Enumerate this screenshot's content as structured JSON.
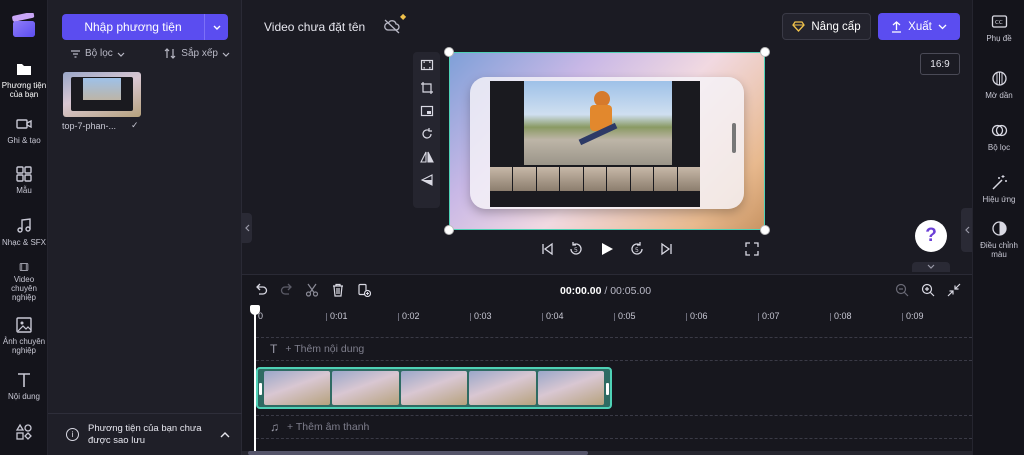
{
  "rail": {
    "items": [
      {
        "label": "Phương tiện của bạn",
        "icon": "folder-icon"
      },
      {
        "label": "Ghi & tạo",
        "icon": "camera-icon"
      },
      {
        "label": "Mẫu",
        "icon": "templates-icon"
      },
      {
        "label": "Nhạc & SFX",
        "icon": "music-icon"
      },
      {
        "label": "Video chuyên nghiệp",
        "icon": "film-icon"
      },
      {
        "label": "Ảnh chuyên nghiệp",
        "icon": "image-icon"
      },
      {
        "label": "Nội dung",
        "icon": "text-icon"
      },
      {
        "label": "",
        "icon": "shapes-icon"
      }
    ]
  },
  "media": {
    "import_label": "Nhập phương tiện",
    "filter_label": "Bộ lọc",
    "sort_label": "Sắp xếp",
    "file_name": "top-7-phan-...",
    "file_check": "✓",
    "unsaved_text": "Phương tiện của bạn chưa được sao lưu"
  },
  "topbar": {
    "project_title": "Video chưa đặt tên",
    "upgrade_label": "Nâng cấp",
    "export_label": "Xuất",
    "aspect_ratio": "16:9"
  },
  "preview": {
    "help_label": "?"
  },
  "right_rail": {
    "items": [
      {
        "label": "Phụ đề",
        "icon": "captions-icon"
      },
      {
        "label": "Mờ dần",
        "icon": "fade-icon"
      },
      {
        "label": "Bộ lọc",
        "icon": "filters-icon"
      },
      {
        "label": "Hiệu ứng",
        "icon": "effects-icon"
      },
      {
        "label": "Điều chỉnh màu",
        "icon": "color-adjust-icon"
      }
    ]
  },
  "timeline": {
    "current_time": "00:00.00",
    "duration": "/ 00:05.00",
    "ticks": [
      "0",
      "0:01",
      "0:02",
      "0:03",
      "0:04",
      "0:05",
      "0:06",
      "0:07",
      "0:08",
      "0:09"
    ],
    "add_text_label": "+ Thêm nội dung",
    "add_audio_label": "+ Thêm âm thanh"
  },
  "colors": {
    "accent": "#5b4df0",
    "clip_border": "#4fd1b6",
    "help_icon": "#6b3fd6",
    "premium": "#f0c24b"
  }
}
